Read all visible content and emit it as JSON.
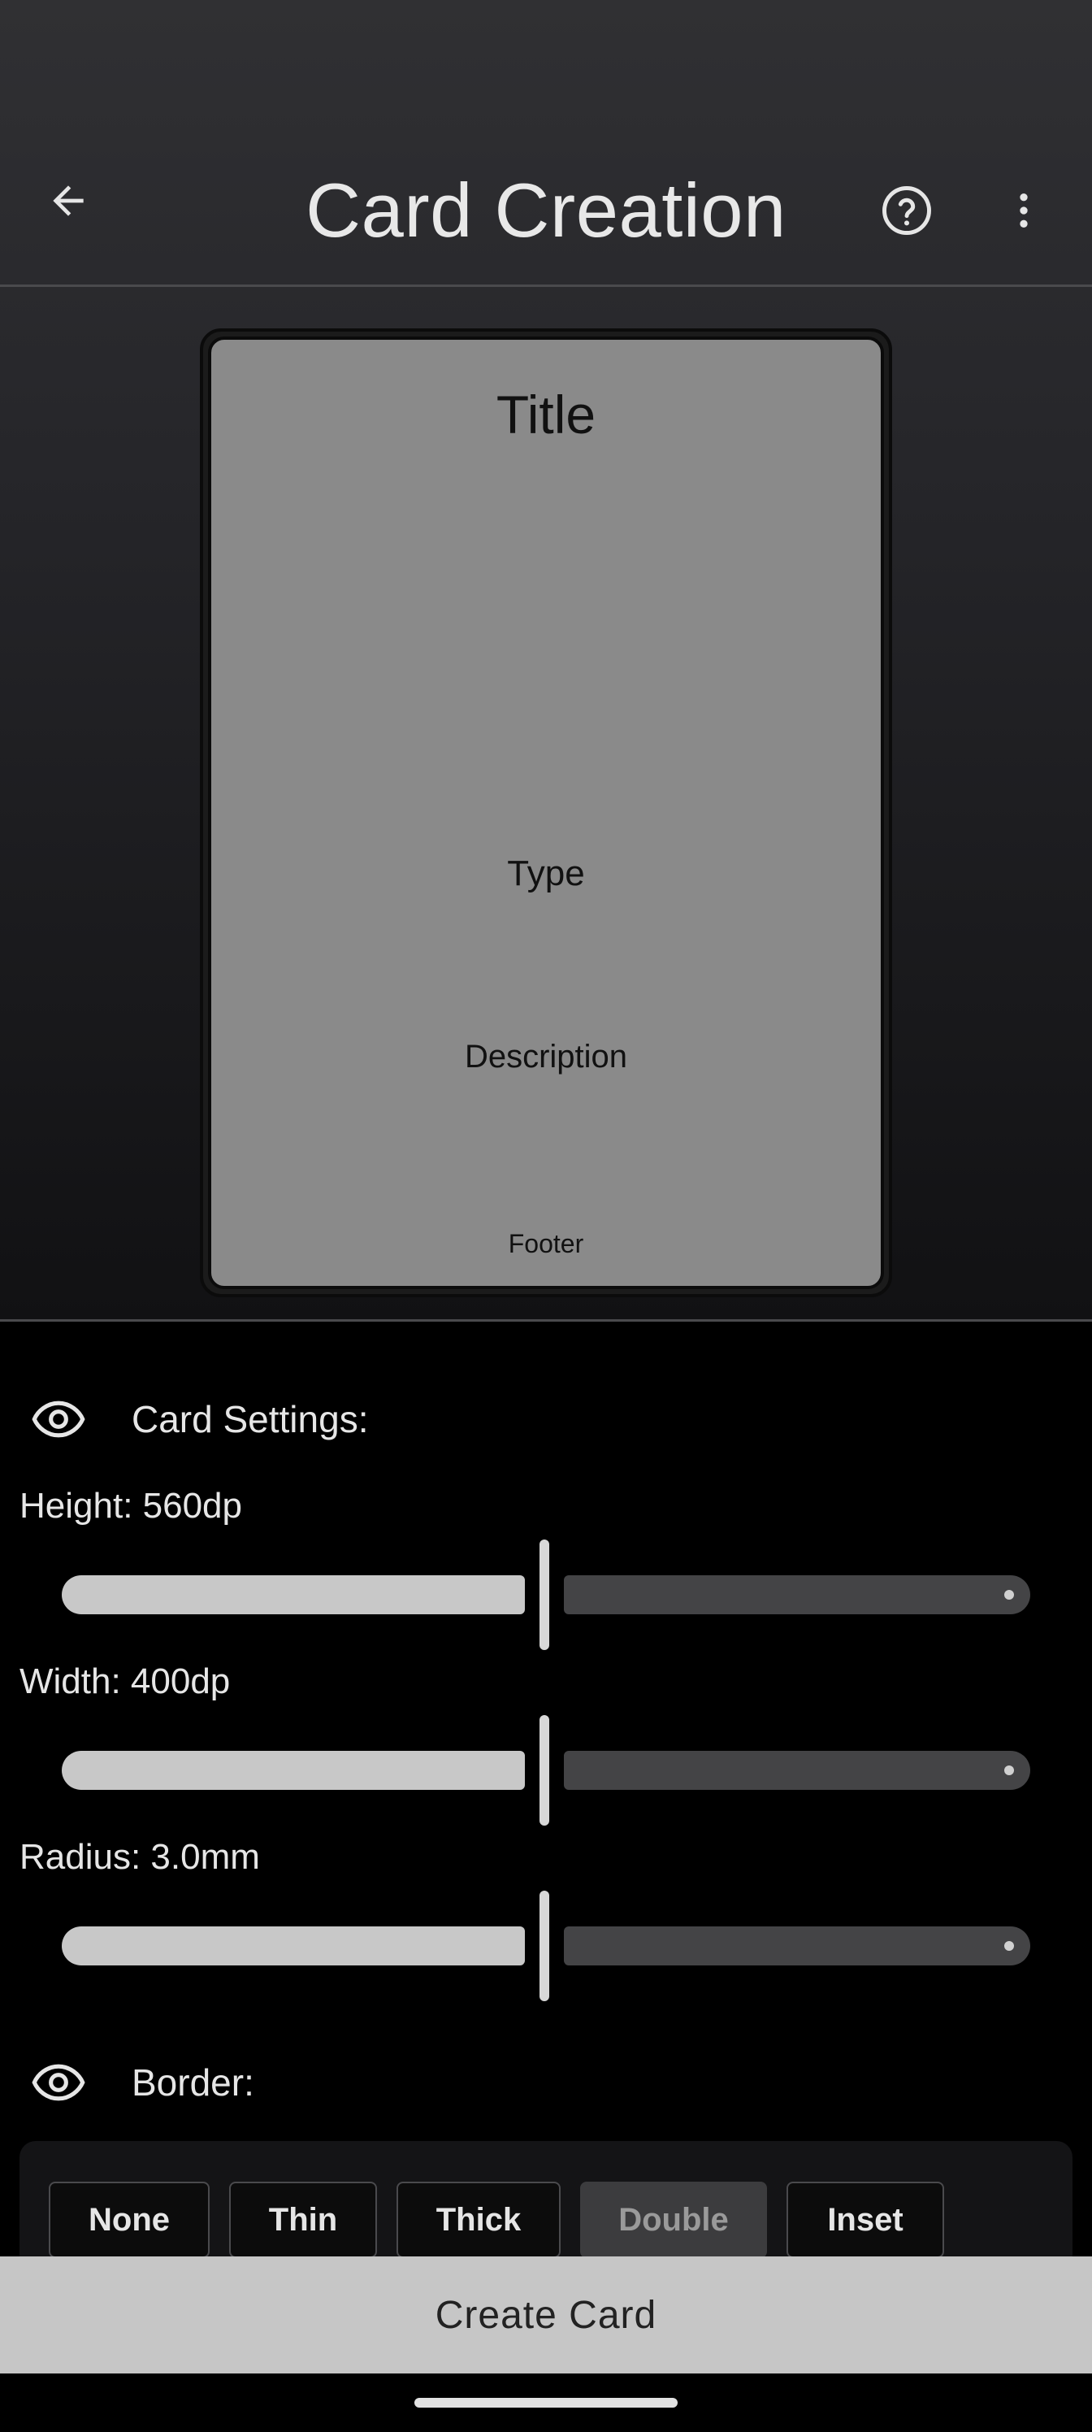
{
  "app_bar": {
    "title": "Card Creation",
    "back_icon": "arrow-back-icon",
    "help_icon": "help-circle-icon",
    "more_icon": "more-vert-icon"
  },
  "card_preview": {
    "title": "Title",
    "type": "Type",
    "description": "Description",
    "footer": "Footer",
    "background_color": "#8a8a8a",
    "border_style": "Double"
  },
  "card_settings": {
    "header": "Card Settings:",
    "visibility_icon": "eye-icon",
    "sliders": [
      {
        "label": "Height: 560dp",
        "value": 560,
        "unit": "dp",
        "fraction": 0.48
      },
      {
        "label": "Width: 400dp",
        "value": 400,
        "unit": "dp",
        "fraction": 0.48
      },
      {
        "label": "Radius: 3.0mm",
        "value": 3.0,
        "unit": "mm",
        "fraction": 0.48
      }
    ]
  },
  "border": {
    "header": "Border:",
    "visibility_icon": "eye-icon",
    "options": [
      "None",
      "Thin",
      "Thick",
      "Double",
      "Inset"
    ],
    "selected": "Double"
  },
  "actions": {
    "create_label": "Create Card"
  },
  "colors": {
    "accent": "#c6c6c6",
    "background": "#000000",
    "selected_option": "#3c3c3e"
  }
}
